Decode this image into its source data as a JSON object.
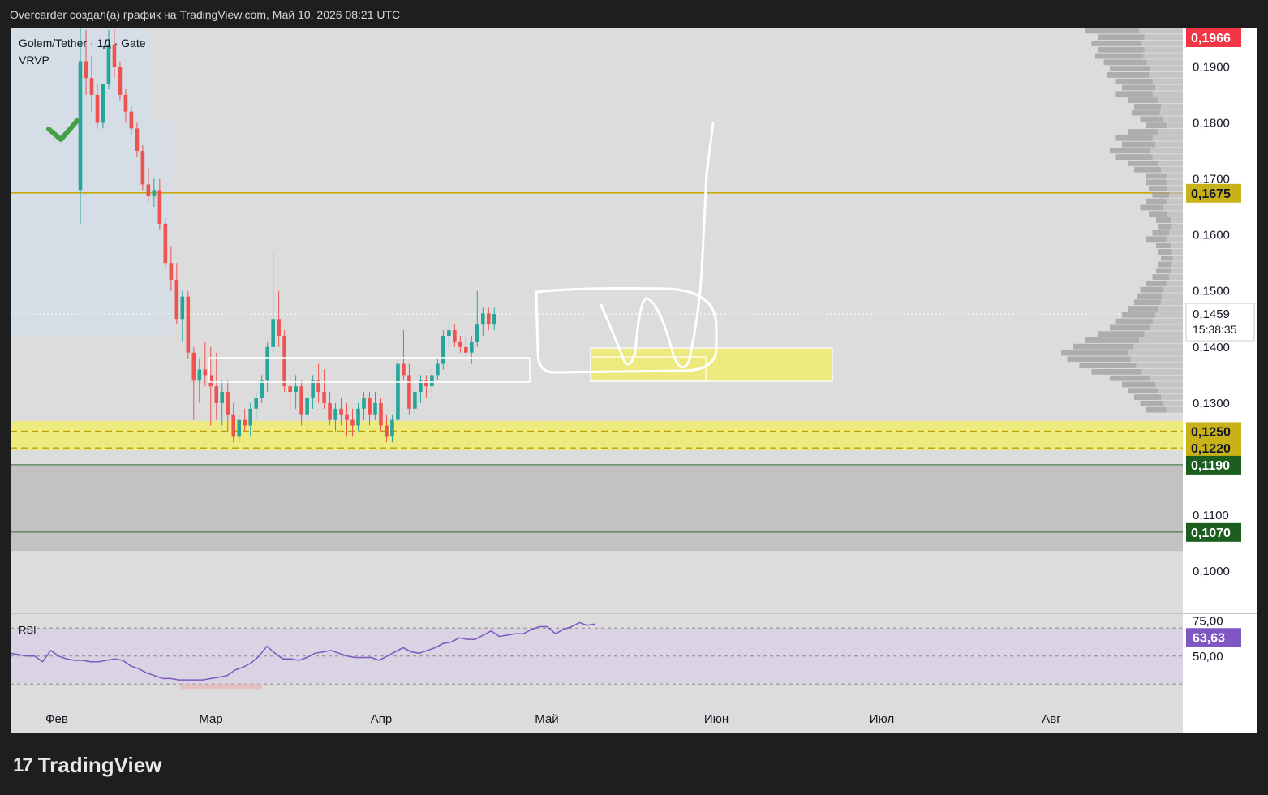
{
  "header": {
    "caption": "Overcarder создал(а) график на TradingView.com, Май 10, 2026 08:21 UTC"
  },
  "legend": {
    "symbol": "Golem/Tether · 1Д · Gate",
    "indicator": "VRVP",
    "rsi_label": "RSI"
  },
  "footer": {
    "brand": "TradingView"
  },
  "colors": {
    "up": "#26a69a",
    "down": "#ef5350",
    "chart_bg": "#dcdcdc",
    "zone_yellow": "#f0ec6e",
    "red_tag": "#f23645",
    "gold_tag": "#c9b11a",
    "green_tag": "#1b5e20",
    "rsi_tag": "#7e57c2"
  },
  "chart_data": {
    "type": "candlestick",
    "symbol": "Golem/Tether",
    "timeframe": "1Д",
    "exchange": "Gate",
    "price_axis": {
      "ticks": [
        "0,1900",
        "0,1800",
        "0,1700",
        "0,1600",
        "0,1500",
        "0,1400",
        "0,1300",
        "0,1100",
        "0,1000"
      ],
      "tick_values": [
        0.19,
        0.18,
        0.17,
        0.16,
        0.15,
        0.14,
        0.13,
        0.11,
        0.1
      ],
      "range": [
        0.0925,
        0.197
      ]
    },
    "time_axis": {
      "labels": [
        "Фев",
        "Мар",
        "Апр",
        "Май",
        "Июн",
        "Июл",
        "Авг"
      ]
    },
    "price_tags": [
      {
        "value": 0.1966,
        "label": "0,1966",
        "color": "red"
      },
      {
        "value": 0.1675,
        "label": "0,1675",
        "color": "gold"
      },
      {
        "value": 0.1459,
        "label": "0,1459",
        "color": "white",
        "countdown": "15:38:35"
      },
      {
        "value": 0.125,
        "label": "0,1250",
        "color": "gold"
      },
      {
        "value": 0.122,
        "label": "0,1220",
        "color": "gold"
      },
      {
        "value": 0.119,
        "label": "0,1190",
        "color": "green"
      },
      {
        "value": 0.107,
        "label": "0,1070",
        "color": "green"
      }
    ],
    "levels": {
      "resistance": 0.1675,
      "support_zone": [
        0.1216,
        0.1268
      ],
      "lower_zone": [
        0.1055,
        0.119
      ]
    },
    "last_price": 0.1459,
    "candles": [
      [
        0.168,
        0.198,
        0.162,
        0.191
      ],
      [
        0.191,
        0.1966,
        0.185,
        0.188
      ],
      [
        0.188,
        0.192,
        0.182,
        0.185
      ],
      [
        0.185,
        0.187,
        0.179,
        0.18
      ],
      [
        0.18,
        0.182,
        0.179,
        0.187
      ],
      [
        0.187,
        0.1966,
        0.186,
        0.194
      ],
      [
        0.194,
        0.1966,
        0.188,
        0.19
      ],
      [
        0.19,
        0.191,
        0.184,
        0.185
      ],
      [
        0.185,
        0.186,
        0.18,
        0.182
      ],
      [
        0.182,
        0.183,
        0.178,
        0.179
      ],
      [
        0.179,
        0.18,
        0.174,
        0.175
      ],
      [
        0.175,
        0.176,
        0.168,
        0.169
      ],
      [
        0.169,
        0.172,
        0.166,
        0.167
      ],
      [
        0.167,
        0.17,
        0.165,
        0.168
      ],
      [
        0.168,
        0.17,
        0.161,
        0.162
      ],
      [
        0.162,
        0.163,
        0.154,
        0.155
      ],
      [
        0.155,
        0.158,
        0.15,
        0.152
      ],
      [
        0.152,
        0.155,
        0.144,
        0.145
      ],
      [
        0.145,
        0.15,
        0.141,
        0.149
      ],
      [
        0.149,
        0.15,
        0.138,
        0.139
      ],
      [
        0.139,
        0.14,
        0.127,
        0.134
      ],
      [
        0.134,
        0.138,
        0.13,
        0.136
      ],
      [
        0.136,
        0.141,
        0.133,
        0.135
      ],
      [
        0.135,
        0.14,
        0.126,
        0.133
      ],
      [
        0.133,
        0.139,
        0.127,
        0.13
      ],
      [
        0.13,
        0.134,
        0.126,
        0.132
      ],
      [
        0.132,
        0.134,
        0.125,
        0.128
      ],
      [
        0.128,
        0.13,
        0.123,
        0.124
      ],
      [
        0.124,
        0.128,
        0.123,
        0.127
      ],
      [
        0.127,
        0.129,
        0.125,
        0.126
      ],
      [
        0.126,
        0.13,
        0.124,
        0.129
      ],
      [
        0.129,
        0.132,
        0.127,
        0.131
      ],
      [
        0.131,
        0.135,
        0.13,
        0.134
      ],
      [
        0.134,
        0.141,
        0.132,
        0.14
      ],
      [
        0.14,
        0.157,
        0.139,
        0.145
      ],
      [
        0.145,
        0.15,
        0.14,
        0.142
      ],
      [
        0.142,
        0.143,
        0.132,
        0.133
      ],
      [
        0.133,
        0.135,
        0.129,
        0.132
      ],
      [
        0.132,
        0.135,
        0.129,
        0.133
      ],
      [
        0.133,
        0.134,
        0.126,
        0.128
      ],
      [
        0.128,
        0.132,
        0.125,
        0.131
      ],
      [
        0.131,
        0.135,
        0.129,
        0.134
      ],
      [
        0.134,
        0.137,
        0.13,
        0.132
      ],
      [
        0.132,
        0.136,
        0.129,
        0.13
      ],
      [
        0.13,
        0.132,
        0.126,
        0.127
      ],
      [
        0.127,
        0.13,
        0.125,
        0.129
      ],
      [
        0.129,
        0.131,
        0.126,
        0.128
      ],
      [
        0.128,
        0.13,
        0.124,
        0.127
      ],
      [
        0.127,
        0.129,
        0.124,
        0.126
      ],
      [
        0.126,
        0.13,
        0.125,
        0.129
      ],
      [
        0.129,
        0.132,
        0.127,
        0.131
      ],
      [
        0.131,
        0.132,
        0.126,
        0.128
      ],
      [
        0.128,
        0.132,
        0.127,
        0.13
      ],
      [
        0.13,
        0.131,
        0.125,
        0.126
      ],
      [
        0.126,
        0.128,
        0.123,
        0.124
      ],
      [
        0.124,
        0.128,
        0.123,
        0.127
      ],
      [
        0.127,
        0.138,
        0.126,
        0.137
      ],
      [
        0.137,
        0.143,
        0.134,
        0.135
      ],
      [
        0.135,
        0.137,
        0.128,
        0.129
      ],
      [
        0.129,
        0.133,
        0.127,
        0.132
      ],
      [
        0.132,
        0.135,
        0.13,
        0.134
      ],
      [
        0.134,
        0.135,
        0.131,
        0.133
      ],
      [
        0.133,
        0.136,
        0.132,
        0.135
      ],
      [
        0.135,
        0.138,
        0.134,
        0.137
      ],
      [
        0.137,
        0.143,
        0.136,
        0.142
      ],
      [
        0.142,
        0.144,
        0.14,
        0.143
      ],
      [
        0.143,
        0.144,
        0.14,
        0.141
      ],
      [
        0.141,
        0.142,
        0.139,
        0.14
      ],
      [
        0.14,
        0.142,
        0.138,
        0.139
      ],
      [
        0.139,
        0.142,
        0.137,
        0.141
      ],
      [
        0.141,
        0.15,
        0.14,
        0.144
      ],
      [
        0.144,
        0.147,
        0.142,
        0.146
      ],
      [
        0.146,
        0.147,
        0.143,
        0.144
      ],
      [
        0.144,
        0.147,
        0.143,
        0.1459
      ]
    ],
    "rsi": {
      "label": "RSI",
      "ticks": [
        "75,00",
        "50,00"
      ],
      "tick_values": [
        75,
        50
      ],
      "upper_band": 70,
      "lower_band": 30,
      "range": [
        18,
        80
      ],
      "current": 63.63,
      "current_label": "63,63",
      "values": [
        52,
        51,
        50,
        50,
        46,
        54,
        50,
        48,
        47,
        47,
        46,
        46,
        47,
        48,
        47,
        43,
        41,
        38,
        36,
        34,
        34,
        33,
        33,
        33,
        33,
        34,
        35,
        36,
        40,
        42,
        45,
        50,
        57,
        52,
        48,
        48,
        47,
        49,
        52,
        53,
        54,
        52,
        50,
        49,
        49,
        49,
        47,
        50,
        53,
        56,
        53,
        52,
        54,
        56,
        59,
        60,
        63,
        62,
        62,
        65,
        68,
        64,
        65,
        66,
        66,
        69,
        71,
        71,
        66,
        69,
        71,
        74,
        72,
        73
      ]
    },
    "volume_profile": [
      0.8,
      0.7,
      0.75,
      0.7,
      0.72,
      0.65,
      0.6,
      0.62,
      0.55,
      0.5,
      0.55,
      0.45,
      0.4,
      0.42,
      0.35,
      0.3,
      0.45,
      0.55,
      0.5,
      0.6,
      0.55,
      0.45,
      0.4,
      0.3,
      0.3,
      0.28,
      0.25,
      0.3,
      0.35,
      0.28,
      0.22,
      0.2,
      0.25,
      0.3,
      0.22,
      0.2,
      0.18,
      0.2,
      0.22,
      0.25,
      0.3,
      0.35,
      0.38,
      0.4,
      0.45,
      0.5,
      0.55,
      0.6,
      0.7,
      0.8,
      0.9,
      1.0,
      0.95,
      0.85,
      0.75,
      0.6,
      0.5,
      0.45,
      0.4,
      0.35,
      0.3
    ]
  }
}
